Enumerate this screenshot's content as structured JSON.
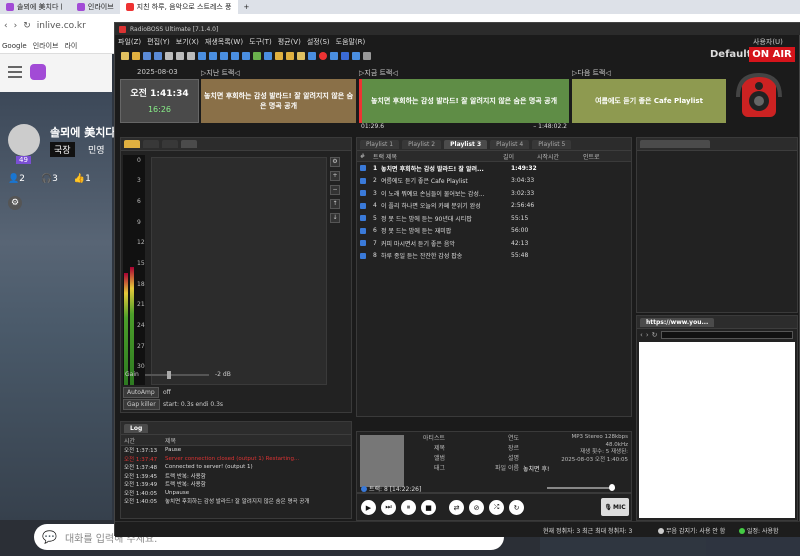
{
  "browser": {
    "tabs": [
      {
        "label": "솔뫼에 美치다ㅣ"
      },
      {
        "label": "인라이브"
      },
      {
        "label": "지친 하루, 음악으로 스트레스 풍"
      }
    ],
    "new_tab": "+",
    "url": "inlive.co.kr",
    "bookmarks": [
      "Google",
      "인라이브",
      "라이"
    ],
    "nav": {
      "back": "‹",
      "forward": "›",
      "reload": "↻"
    }
  },
  "web": {
    "channel_name": "솔뫼에 美치다",
    "badge": "국장",
    "badge_next": "민영",
    "level": "49",
    "stats": [
      "2",
      "3",
      "1"
    ],
    "chat_placeholder": "대화를 입력해 주세요."
  },
  "app": {
    "title": "RadioBOSS Ultimate [7.1.4.0]",
    "menus": [
      "파일(Z)",
      "편집(Y)",
      "보기(X)",
      "재생목록(W)",
      "도구(T)",
      "평균(V)",
      "설정(S)",
      "도움말(R)"
    ],
    "user_label": "사용자(U)",
    "default_label": "Default",
    "on_air": "ON AIR",
    "date": "2025-08-03",
    "time": "오전 1:41:34",
    "countdown": "16:26",
    "prev_label": "▷지난 트랙◁",
    "prev_title": "놓치면 후회하는 감성 발라드! 잘 알려지지 않은 숨은 명곡 공개",
    "cur_label": "▷지금 트랙◁",
    "cur_title": "놓치면 후회하는 감성 발라드! 잘 알려지지 않은 숨은 명곡 공개",
    "cur_elapsed": "01:29.6",
    "cur_remaining": "– 1:48:02.2",
    "next_label": "▷다음 트랙◁",
    "next_title": "여름에도 듣기 좋은 Cafe Playlist"
  },
  "playlist": {
    "tabs": [
      "Playlist 1",
      "Playlist 2",
      "Playlist 3",
      "Playlist 4",
      "Playlist 5"
    ],
    "headers": [
      "#",
      "트랙 제목",
      "길이",
      "시작시간",
      "인트로"
    ],
    "rows": [
      {
        "n": "1",
        "t": "놓치면 후회하는 감성 발라드! 잘 알려...",
        "d": "1:49:32"
      },
      {
        "n": "2",
        "t": "여름에도 듣기 좋은 Cafe Playlist",
        "d": "3:04:33"
      },
      {
        "n": "3",
        "t": "이 노래 뭐예요 손님들이 물어보는 감성...",
        "d": "3:02:33"
      },
      {
        "n": "4",
        "t": "이 플리 하나면 오늘의 카페 분위기 완성",
        "d": "2:56:46"
      },
      {
        "n": "5",
        "t": "정 못 드는 밤에 듣는 90년대 시티팝",
        "d": "55:15"
      },
      {
        "n": "6",
        "t": "정 못 드는 밤에 듣는 재미팝",
        "d": "56:00"
      },
      {
        "n": "7",
        "t": "커피 마시면서 듣기 좋은 음악",
        "d": "42:13"
      },
      {
        "n": "8",
        "t": "하루 종일 듣는 잔잔한 감성 팝송",
        "d": "55:48"
      }
    ]
  },
  "left": {
    "scale": [
      "0",
      "3",
      "6",
      "9",
      "12",
      "15",
      "18",
      "21",
      "24",
      "27",
      "30"
    ],
    "gain_label": "Gain",
    "gain_value": "-2 dB",
    "autoamp_label": "AutoAmp",
    "autoamp_value": "off",
    "gapkiller_label": "Gap killer",
    "gapkiller_value": "start: 0.3s endi 0.3s"
  },
  "log": {
    "tab": "Log",
    "headers": [
      "시간",
      "제목"
    ],
    "rows": [
      {
        "t": "오전 1:37:13",
        "e": "Pause",
        "err": false
      },
      {
        "t": "오전 1:37:47",
        "e": "Server connection closed (output 1) Restarting...",
        "err": true
      },
      {
        "t": "오전 1:37:48",
        "e": "Connected to server! (output 1)",
        "err": false
      },
      {
        "t": "오전 1:39:45",
        "e": "트랙 반복: 사용함",
        "err": false
      },
      {
        "t": "오전 1:39:49",
        "e": "트랙 반복: 사용함",
        "err": false
      },
      {
        "t": "오전 1:40:05",
        "e": "Unpause",
        "err": false
      },
      {
        "t": "오전 1:40:05",
        "e": "놓치면 후회하는 감성 발라드! 잘 알려지지 않은 숨은 명곡 공개",
        "err": false
      }
    ]
  },
  "info": {
    "labels": [
      "아티스트",
      "제목",
      "앨범",
      "태그"
    ],
    "labels2": [
      "연도",
      "장르",
      "설명",
      "파일 이름"
    ],
    "filename_value": "놓치면 후!",
    "format": "MP3 Stereo 128kbps",
    "rate": "48.0kHz",
    "plays": "재생 횟수: 5 재생된:",
    "last": "2025-08-03 오전 1:40:05",
    "track_counter": "트랙: 8 [14:22:26]",
    "mic": "MIC"
  },
  "webpanel": {
    "tab": "https://www.you..."
  },
  "status": {
    "center": "현재 정취자: 3  최근 최대 청취자: 3",
    "mid": "무음 감지기: 사용 안 함",
    "right": "일정: 사용함"
  }
}
